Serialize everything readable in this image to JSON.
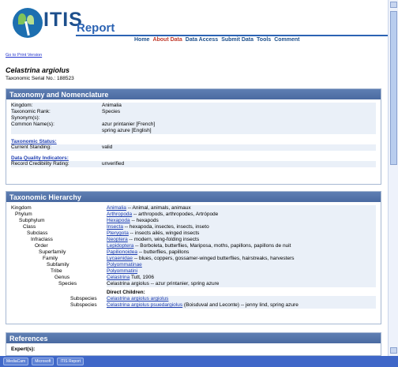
{
  "header": {
    "logo_text": "ITIS",
    "report_text": "Report",
    "nav": [
      "Home",
      "About Data",
      "Data Access",
      "Submit Data",
      "Tools",
      "Comment"
    ]
  },
  "print_link": "Go to Print Version",
  "species": {
    "title": "Celastrina argiolus",
    "tsn": "Taxonomic Serial No.: 188523"
  },
  "taxonomy": {
    "heading": "Taxonomy and Nomenclature",
    "kingdom_label": "Kingdom:",
    "kingdom_value": "Animalia",
    "rank_label": "Taxonomic Rank:",
    "rank_value": "Species",
    "synonyms_label": "Synonym(s):",
    "common_label": "Common Name(s):",
    "common_1": "azur printanier [French]",
    "common_2": "spring azure [English]",
    "status_heading": "Taxonomic Status:",
    "standing_label": "Current Standing:",
    "standing_value": "valid",
    "quality_heading": "Data Quality Indicators:",
    "credibility_label": "Record Credibility Rating:",
    "credibility_value": "unverified"
  },
  "hierarchy": {
    "heading": "Taxonomic Hierarchy",
    "rows": [
      {
        "rank": "Kingdom",
        "name": "Animalia",
        "desc": " -- Animal, animals, animaux"
      },
      {
        "rank": "Phylum",
        "name": "Arthropoda",
        "desc": " -- arthropods, arthropodes, Artrópode"
      },
      {
        "rank": "Subphylum",
        "name": "Hexapoda",
        "desc": " -- hexapods"
      },
      {
        "rank": "Class",
        "name": "Insecta",
        "desc": " -- hexapoda, insectes, insects, inseto"
      },
      {
        "rank": "Subclass",
        "name": "Pterygota",
        "desc": " -- insects ailés, winged insects"
      },
      {
        "rank": "Infraclass",
        "name": "Neoptera",
        "desc": " -- modern, wing-folding insects"
      },
      {
        "rank": "Order",
        "name": "Lepidoptera",
        "desc": " -- Borboleta, butterflies, Mariposa, moths, papillons, papillons de nuit"
      },
      {
        "rank": "Superfamily",
        "name": "Papilionoidea",
        "desc": " -- butterflies, papillons"
      },
      {
        "rank": "Family",
        "name": "Lycaenidae",
        "desc": " -- blues, coppers, gossamer-winged butterflies, hairstreaks, harvesters"
      },
      {
        "rank": "Subfamily",
        "name": "Polyommatinae",
        "desc": ""
      },
      {
        "rank": "Tribe",
        "name": "Polyommatini",
        "desc": ""
      },
      {
        "rank": "Genus",
        "name": "Celastrina",
        "desc": " Tutt, 1906"
      },
      {
        "rank": "Species",
        "name": "Celastrina argiolus",
        "desc": " -- azur printanier, spring azure"
      }
    ],
    "children_heading": "Direct Children:",
    "children": [
      {
        "rank": "Subspecies",
        "name": "Celastrina argiolus argiolus",
        "desc": ""
      },
      {
        "rank": "Subspecies",
        "name": "Celastrina argiolus psuedargiolus",
        "desc": " (Boisduval and Leconte) -- jenny lind, spring azure"
      }
    ]
  },
  "references": {
    "heading": "References",
    "experts_label": "Expert(s):"
  },
  "taskbar": {
    "items": [
      "MediaCam",
      "Microsoft",
      "ITIS Report"
    ]
  }
}
